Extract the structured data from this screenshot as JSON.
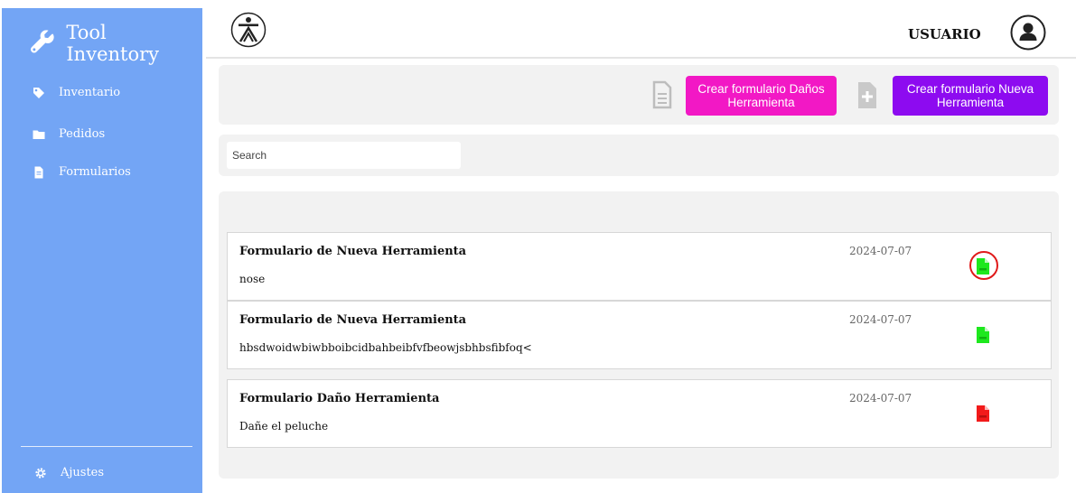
{
  "sidebar": {
    "brand_title": "Tool Inventory",
    "items": [
      {
        "label": "Inventario",
        "icon": "tag-icon"
      },
      {
        "label": "Pedidos",
        "icon": "folder-icon"
      },
      {
        "label": "Formularios",
        "icon": "file-icon"
      }
    ],
    "settings_label": "Ajustes",
    "background_color": "#73a5f5"
  },
  "header": {
    "logo": "sena-logo",
    "user_label": "USUARIO"
  },
  "actions": {
    "damage_form_button": "Crear formulario Daños Herramienta",
    "new_tool_form_button": "Crear formulario Nueva Herramienta",
    "damage_button_color": "#f218c5",
    "new_button_color": "#8d0bf0"
  },
  "search": {
    "placeholder": "Search",
    "value": ""
  },
  "forms": [
    {
      "title": "Formulario de Nueva Herramienta",
      "description": "nose",
      "date": "2024-07-07",
      "pdf_color": "#1ee81e"
    },
    {
      "title": "Formulario de Nueva Herramienta",
      "description": "hbsdwoidwbiwbboibcidbahbeibfvfbeowjsbhbsfibfoq<",
      "date": "2024-07-07",
      "pdf_color": "#1ee81e"
    },
    {
      "title": "Formulario Daño Herramienta",
      "description": "Dañe el peluche",
      "date": "2024-07-07",
      "pdf_color": "#f21a1a"
    }
  ]
}
